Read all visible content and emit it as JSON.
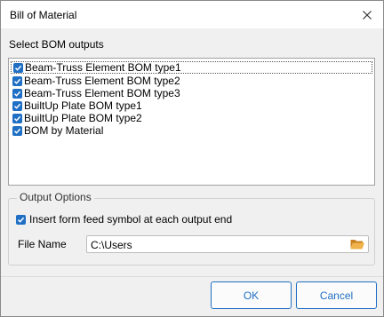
{
  "window": {
    "title": "Bill of Material"
  },
  "bom_section": {
    "label": "Select BOM outputs",
    "items": [
      {
        "label": "Beam-Truss Element BOM type1",
        "checked": true
      },
      {
        "label": "Beam-Truss Element BOM type2",
        "checked": true
      },
      {
        "label": "Beam-Truss Element BOM type3",
        "checked": true
      },
      {
        "label": "BuiltUp Plate BOM type1",
        "checked": true
      },
      {
        "label": "BuiltUp Plate BOM type2",
        "checked": true
      },
      {
        "label": "BOM by Material",
        "checked": true
      }
    ]
  },
  "output_options": {
    "legend": "Output Options",
    "form_feed_label": "Insert form feed symbol at each output end",
    "form_feed_checked": true,
    "file_name_label": "File Name",
    "file_name_value": "C:\\Users"
  },
  "buttons": {
    "ok": "OK",
    "cancel": "Cancel"
  },
  "colors": {
    "accent": "#1f6fc4",
    "dialog_bg": "#f0f0f0",
    "folder_icon": "#e8a23a"
  },
  "icons": {
    "close": "close-icon",
    "checkbox": "checkmark-icon",
    "browse": "folder-open-icon"
  }
}
